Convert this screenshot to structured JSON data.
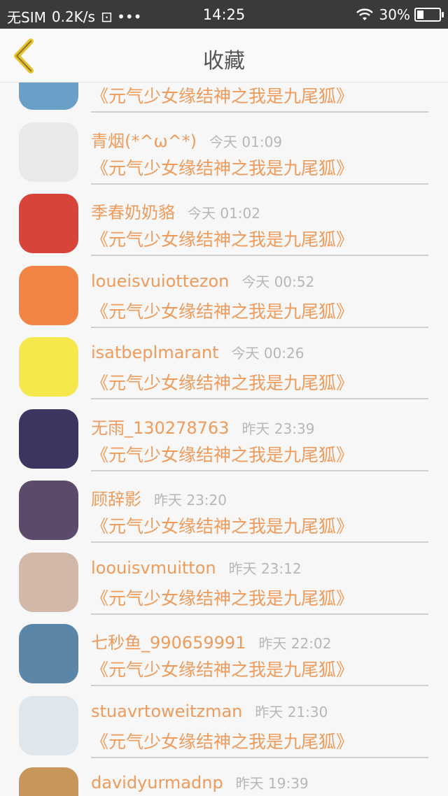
{
  "status_bar": {
    "carrier": "无SIM",
    "speed": "0.2K/s",
    "extra": "⊡ •••",
    "time": "14:25",
    "battery": "30%",
    "battery_level": 0.3
  },
  "nav": {
    "title": "收藏"
  },
  "colors": {
    "accent": "#ee9b5c",
    "back_icon": "#e8c22a"
  },
  "items": [
    {
      "username": "",
      "time": "",
      "title": "《元气少女缘结神之我是九尾狐》",
      "avatar_color": "#6aa0c8"
    },
    {
      "username": "青烟(*^ω^*)",
      "time": "今天 01:09",
      "title": "《元气少女缘结神之我是九尾狐》",
      "avatar_color": "#e9e9e9"
    },
    {
      "username": "季春奶奶貉",
      "time": "今天 01:02",
      "title": "《元气少女缘结神之我是九尾狐》",
      "avatar_color": "#d8443a"
    },
    {
      "username": "loueisvuiottezon",
      "time": "今天 00:52",
      "title": "《元气少女缘结神之我是九尾狐》",
      "avatar_color": "#f28446"
    },
    {
      "username": "isatbeplmarant",
      "time": "今天 00:26",
      "title": "《元气少女缘结神之我是九尾狐》",
      "avatar_color": "#f5e84c"
    },
    {
      "username": "无雨_130278763",
      "time": "昨天 23:39",
      "title": "《元气少女缘结神之我是九尾狐》",
      "avatar_color": "#3c3560"
    },
    {
      "username": "顾辞影",
      "time": "昨天 23:20",
      "title": "《元气少女缘结神之我是九尾狐》",
      "avatar_color": "#5b4a6a"
    },
    {
      "username": "loouisvmuitton",
      "time": "昨天 23:12",
      "title": "《元气少女缘结神之我是九尾狐》",
      "avatar_color": "#d2b8a8"
    },
    {
      "username": "七秒鱼_990659991",
      "time": "昨天 22:02",
      "title": "《元气少女缘结神之我是九尾狐》",
      "avatar_color": "#5b86a8"
    },
    {
      "username": "stuavrtoweitzman",
      "time": "昨天 21:30",
      "title": "《元气少女缘结神之我是九尾狐》",
      "avatar_color": "#dfe6ec"
    },
    {
      "username": "davidyurmadnp",
      "time": "昨天 19:39",
      "title": "",
      "avatar_color": "#c8955a"
    }
  ]
}
